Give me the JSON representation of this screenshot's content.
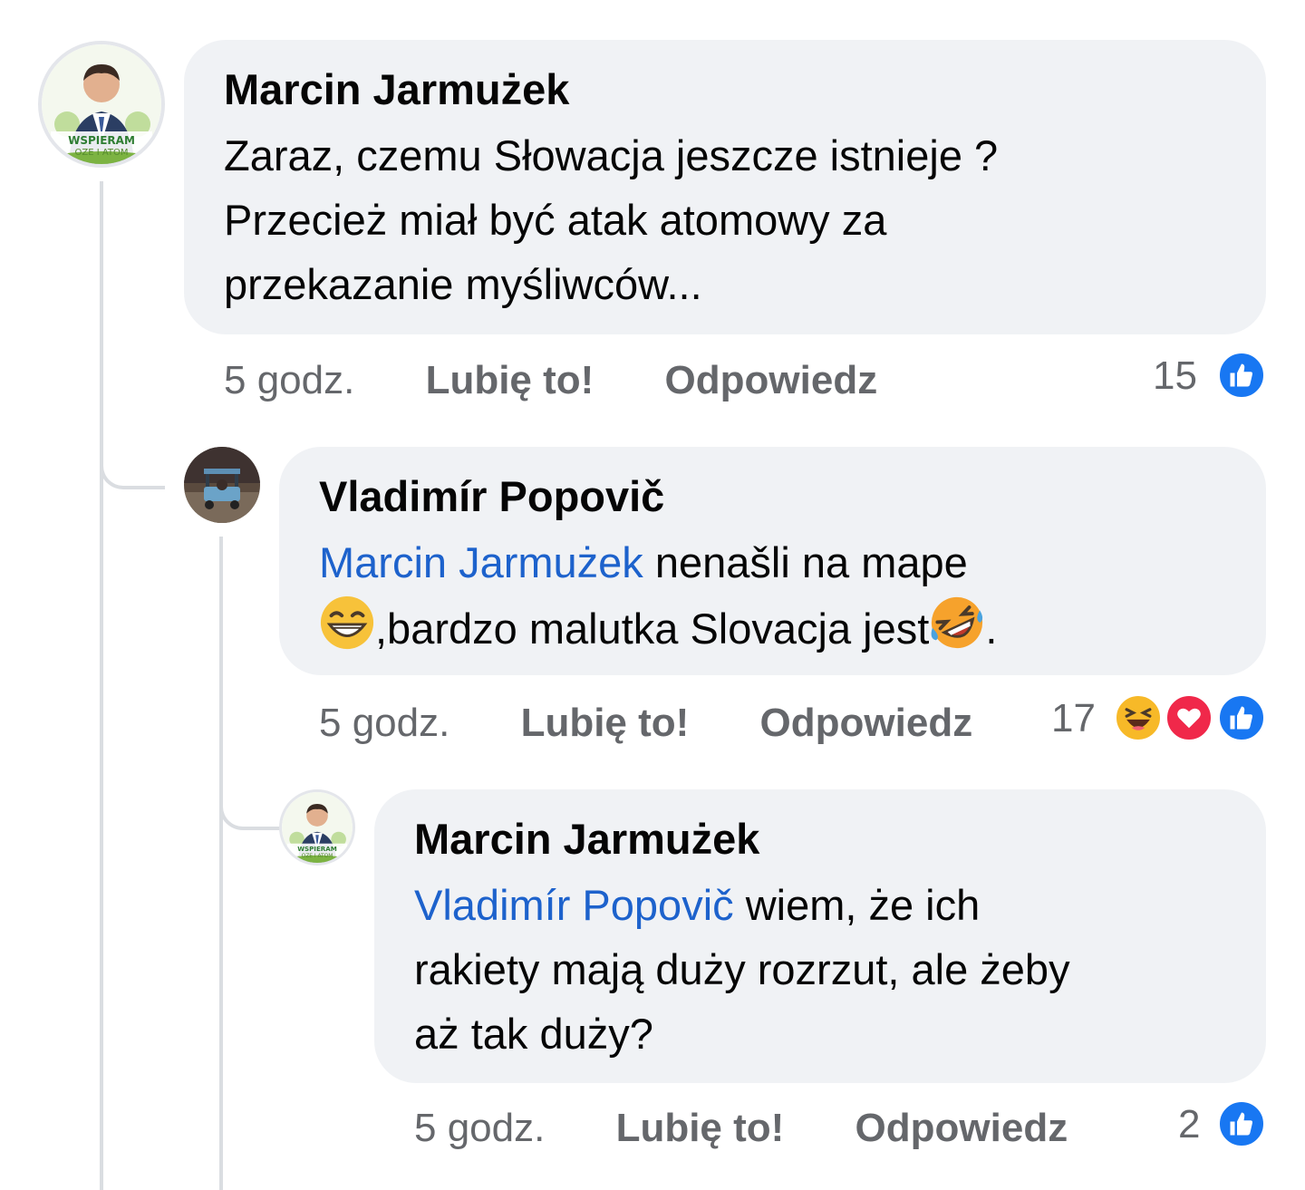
{
  "comments": [
    {
      "author": "Marcin Jarmużek",
      "avatar_caption_1": "WSPIERAM",
      "avatar_caption_2": "OZE I ATOM",
      "line1": "Zaraz, czemu Słowacja jeszcze istnieje ?",
      "line2": "Przecież miał być atak atomowy za",
      "line3": "przekazanie myśliwców...",
      "time": "5 godz.",
      "like_label": "Lubię to!",
      "reply_label": "Odpowiedz",
      "reaction_count": "15",
      "reactions": [
        "like-icon"
      ]
    },
    {
      "author": "Vladimír Popovič",
      "mention": "Marcin Jarmużek",
      "line1_rest": " nenašli na mape",
      "line2_text": ",bardzo malutka Slovacja jest",
      "line2_end": ".",
      "emojis": [
        "grinning-face-icon",
        "rolling-laughing-face-icon"
      ],
      "time": "5 godz.",
      "like_label": "Lubię to!",
      "reply_label": "Odpowiedz",
      "reaction_count": "17",
      "reactions": [
        "haha-icon",
        "love-icon",
        "like-icon"
      ]
    },
    {
      "author": "Marcin Jarmużek",
      "avatar_caption_1": "WSPIERAM",
      "avatar_caption_2": "OZE I ATOM",
      "mention": "Vladimír Popovič",
      "line1_rest": " wiem, że ich",
      "line2": "rakiety mają duży rozrzut, ale żeby",
      "line3": "aż tak duży?",
      "time": "5 godz.",
      "like_label": "Lubię to!",
      "reply_label": "Odpowiedz",
      "reaction_count": "2",
      "reactions": [
        "like-icon"
      ]
    }
  ],
  "colors": {
    "bubble": "#f0f2f5",
    "mention": "#1d62cc",
    "meta": "#65676b",
    "like": "#1877f2",
    "love": "#f0284a",
    "haha": "#f7b928"
  }
}
